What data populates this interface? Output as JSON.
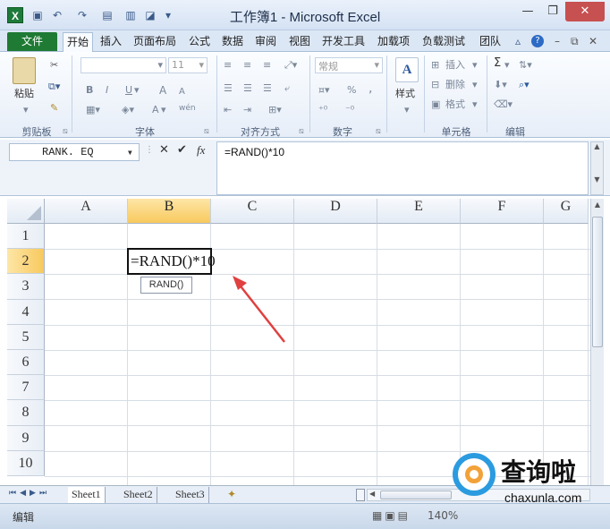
{
  "titlebar": {
    "app_icon": "X",
    "title": "工作簿1 - Microsoft Excel"
  },
  "tabs": {
    "file": "文件",
    "items": [
      "开始",
      "插入",
      "页面布局",
      "公式",
      "数据",
      "审阅",
      "视图",
      "开发工具",
      "加载项",
      "负载测试",
      "团队"
    ],
    "active": "开始"
  },
  "ribbon": {
    "clipboard": {
      "paste": "粘贴",
      "label": "剪贴板"
    },
    "font": {
      "size": "11",
      "bold": "B",
      "italic": "I",
      "underline": "U",
      "grow": "A",
      "shrink": "A",
      "color": "A",
      "wen": "wén",
      "label": "字体"
    },
    "align": {
      "label": "对齐方式"
    },
    "number": {
      "format": "常规",
      "pct": "%",
      "comma": ",",
      "label": "数字"
    },
    "style": {
      "label": "样式"
    },
    "cells": {
      "insert": "插入",
      "delete": "删除",
      "format": "格式",
      "label": "单元格"
    },
    "edit": {
      "sigma": "Σ",
      "label": "编辑"
    }
  },
  "formula_bar": {
    "name_box": "RANK. EQ",
    "fx": "fx",
    "formula": "=RAND()*10"
  },
  "grid": {
    "columns": [
      "A",
      "B",
      "C",
      "D",
      "E",
      "F",
      "G"
    ],
    "rows": [
      "1",
      "2",
      "3",
      "4",
      "5",
      "6",
      "7",
      "8",
      "9",
      "10"
    ],
    "active_cell_text": "=RAND()*10",
    "tooltip": "RAND()"
  },
  "sheets": [
    "Sheet1",
    "Sheet2",
    "Sheet3"
  ],
  "status": {
    "mode": "编辑",
    "zoom": "140%"
  },
  "watermark": {
    "text_cn": "查询啦",
    "text_url": "chaxunla.com"
  },
  "colors": {
    "accent_green": "#1f7a34",
    "selected_header": "#f8c95e",
    "arrow": "#e04040"
  }
}
